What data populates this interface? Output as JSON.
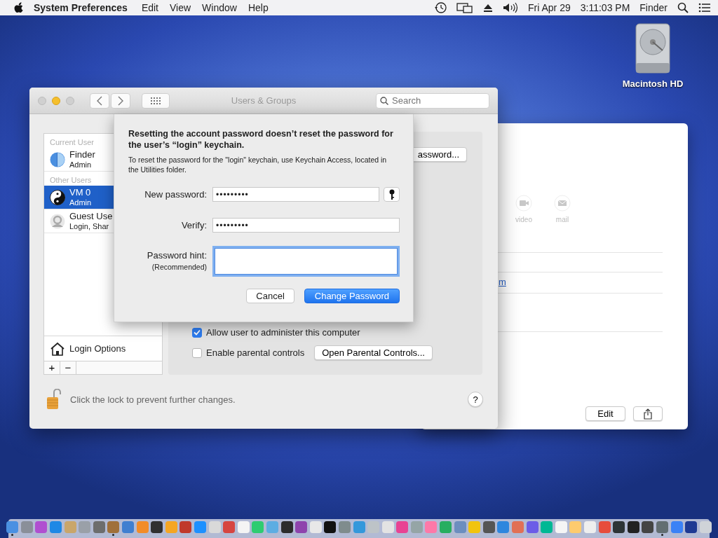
{
  "menu_bar": {
    "app": "System Preferences",
    "menus": [
      "Edit",
      "View",
      "Window",
      "Help"
    ],
    "date": "Fri Apr 29",
    "time": "3:11:03 PM",
    "user": "Finder"
  },
  "desktop_disk": {
    "label": "Macintosh HD"
  },
  "contact_card": {
    "actions": [
      {
        "label": "video",
        "kind": "video"
      },
      {
        "label": "mail",
        "kind": "mail"
      }
    ],
    "partial_link": "m",
    "button": "Edit"
  },
  "window": {
    "title": "Users & Groups",
    "search": {
      "placeholder": "Search"
    },
    "sidebar": {
      "sections": [
        {
          "header": "Current User",
          "users": [
            {
              "name": "Finder",
              "role": "Admin",
              "kind": "finder",
              "selected": false
            }
          ]
        },
        {
          "header": "Other Users",
          "users": [
            {
              "name": "VM 0",
              "role": "Admin",
              "kind": "yinyang",
              "selected": true
            },
            {
              "name": "Guest Use",
              "role": "Login, Shar",
              "kind": "guest",
              "selected": false
            }
          ]
        }
      ],
      "login_options": "Login Options",
      "add": "+",
      "remove": "−"
    },
    "partial_button": "assword...",
    "options": [
      {
        "label": "Allow user to administer this computer",
        "checked": true
      },
      {
        "label": "Enable parental controls",
        "checked": false
      }
    ],
    "parental_button": "Open Parental Controls...",
    "lock_text": "Click the lock to prevent further changes.",
    "help": "?"
  },
  "sheet": {
    "title": "Resetting the account password doesn’t reset the password for the user’s “login” keychain.",
    "message": "To reset the password for the \"login\" keychain, use Keychain Access, located in the Utilities folder.",
    "fields": [
      {
        "label": "New password:",
        "value": "•••••••••",
        "kind": "password",
        "focused": false
      },
      {
        "label": "Verify:",
        "value": "•••••••••",
        "kind": "plain",
        "focused": false
      },
      {
        "label": "Password hint:",
        "sublabel": "(Recommended)",
        "kind": "hint",
        "focused": true
      }
    ],
    "buttons": [
      {
        "label": "Cancel",
        "default": false
      },
      {
        "label": "Change Password",
        "default": true
      }
    ]
  },
  "dock": {
    "items": [
      {
        "color": "#4a90e2",
        "running": true
      },
      {
        "color": "#8a8f99",
        "running": false
      },
      {
        "color": "#b04fd0",
        "running": false
      },
      {
        "color": "#1e88e5",
        "running": false
      },
      {
        "color": "#c9a66b",
        "running": false
      },
      {
        "color": "#9aa0a8",
        "running": false
      },
      {
        "color": "#6d6d6d",
        "running": false
      },
      {
        "color": "#a0703a",
        "running": true
      },
      {
        "color": "#3f7fd0",
        "running": false
      },
      {
        "color": "#f28c28",
        "running": false
      },
      {
        "color": "#303030",
        "running": false
      },
      {
        "color": "#f5a623",
        "running": false
      },
      {
        "color": "#c0392b",
        "running": false
      },
      {
        "color": "#1e90ff",
        "running": false
      },
      {
        "color": "#d9d9d9",
        "running": false
      },
      {
        "color": "#d64541",
        "running": false
      },
      {
        "color": "#f4f4f4",
        "running": false
      },
      {
        "color": "#2ecc71",
        "running": false
      },
      {
        "color": "#5dade2",
        "running": false
      },
      {
        "color": "#2c2c2c",
        "running": false
      },
      {
        "color": "#8e44ad",
        "running": false
      },
      {
        "color": "#e8e8e8",
        "running": false
      },
      {
        "color": "#111111",
        "running": false
      },
      {
        "color": "#7f8c8d",
        "running": false
      },
      {
        "color": "#3498db",
        "running": false
      },
      {
        "color": "#bdc3c7",
        "running": false
      },
      {
        "color": "#e3e3e3",
        "running": false
      },
      {
        "color": "#e84393",
        "running": false
      },
      {
        "color": "#95a5a6",
        "running": false
      },
      {
        "color": "#fd79a8",
        "running": false
      },
      {
        "color": "#27ae60",
        "running": false
      },
      {
        "color": "#6c8ebf",
        "running": false
      },
      {
        "color": "#f1c40f",
        "running": false
      },
      {
        "color": "#555555",
        "running": false
      },
      {
        "color": "#2e86de",
        "running": false
      },
      {
        "color": "#e17055",
        "running": false
      },
      {
        "color": "#6c5ce7",
        "running": false
      },
      {
        "color": "#00b894",
        "running": false
      },
      {
        "color": "#f5f5f5",
        "running": false
      },
      {
        "color": "#fdcb6e",
        "running": false
      },
      {
        "color": "#eeeeee",
        "running": false
      },
      {
        "color": "#e74c3c",
        "running": false
      },
      {
        "color": "#2d3436",
        "running": false
      },
      {
        "color": "#222222",
        "running": false
      },
      {
        "color": "#444444",
        "running": false
      },
      {
        "color": "#636e72",
        "running": true
      },
      {
        "color": "#3b82f6",
        "running": false
      },
      {
        "color": "#1f3a93",
        "running": false
      },
      {
        "color": "#cfd3d8",
        "running": false
      }
    ]
  }
}
